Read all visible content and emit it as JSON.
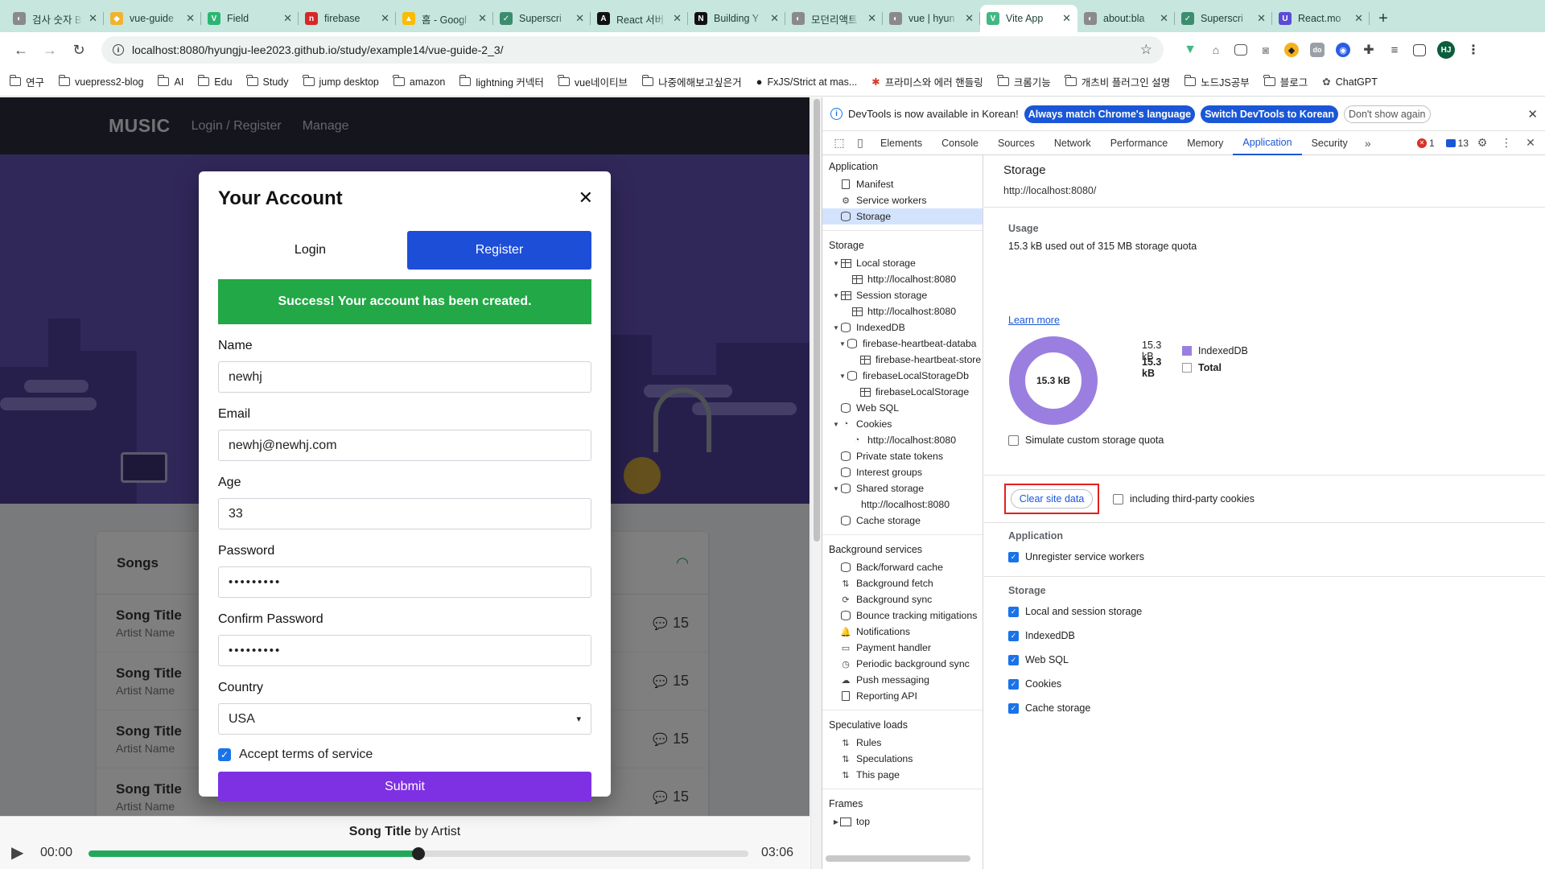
{
  "tabs": [
    {
      "title": "검사 숫자 B",
      "color": "#8a8a8a",
      "glyph": "◐"
    },
    {
      "title": "vue-guide",
      "color": "#f0b32f",
      "glyph": "◆"
    },
    {
      "title": "Field",
      "color": "#2bb673",
      "glyph": "V"
    },
    {
      "title": "firebase",
      "color": "#d62828",
      "glyph": "n"
    },
    {
      "title": "홈 - Googl",
      "color": "#fbbc04",
      "glyph": "▲"
    },
    {
      "title": "Superscri",
      "color": "#3b8d6e",
      "glyph": "✓"
    },
    {
      "title": "React 서버",
      "color": "#111111",
      "glyph": "A"
    },
    {
      "title": "Building Y",
      "color": "#111111",
      "glyph": "N"
    },
    {
      "title": "모던리액트",
      "color": "#8a8a8a",
      "glyph": "◐"
    },
    {
      "title": "vue | hyun",
      "color": "#8a8a8a",
      "glyph": "◐"
    },
    {
      "title": "Vite App",
      "color": "#42b883",
      "glyph": "V",
      "active": true
    },
    {
      "title": "about:bla",
      "color": "#8a8a8a",
      "glyph": "◐"
    },
    {
      "title": "Superscri",
      "color": "#3b8d6e",
      "glyph": "✓"
    },
    {
      "title": "React.mo",
      "color": "#5b4bd6",
      "glyph": "U"
    }
  ],
  "omnibox": {
    "url": "localhost:8080/hyungju-lee2023.github.io/study/example14/vue-guide-2_3/"
  },
  "profile_initials": "HJ",
  "bookmarks": [
    "연구",
    "vuepress2-blog",
    "AI",
    "Edu",
    "Study",
    "jump desktop",
    "amazon",
    "lightning 커넥터",
    "vue네이티브",
    "나중에해보고싶은거",
    "FxJS/Strict at mas...",
    "프라미스와 에러 핸들링",
    "크롬기능",
    "개츠비 플러그인 설명",
    "노드JS공부",
    "블로그",
    "ChatGPT"
  ],
  "site": {
    "brand": "MUSIC",
    "nav": [
      "Login / Register",
      "Manage"
    ],
    "songs_heading": "Songs",
    "songs": [
      {
        "title": "Song Title",
        "artist": "Artist Name",
        "count": "15"
      },
      {
        "title": "Song Title",
        "artist": "Artist Name",
        "count": "15"
      },
      {
        "title": "Song Title",
        "artist": "Artist Name",
        "count": "15"
      },
      {
        "title": "Song Title",
        "artist": "Artist Name",
        "count": "15"
      }
    ],
    "player": {
      "song": "Song Title",
      "by": "by Artist",
      "time_start": "00:00",
      "time_end": "03:06",
      "progress": 0.5
    }
  },
  "modal": {
    "title": "Your Account",
    "tab_login": "Login",
    "tab_register": "Register",
    "alert": "Success! Your account has been created.",
    "fields": {
      "name_label": "Name",
      "name_value": "newhj",
      "email_label": "Email",
      "email_value": "newhj@newhj.com",
      "age_label": "Age",
      "age_value": "33",
      "password_label": "Password",
      "password_value": "•••••••••",
      "confirm_label": "Confirm Password",
      "confirm_value": "•••••••••",
      "country_label": "Country",
      "country_value": "USA"
    },
    "terms": "Accept terms of service",
    "submit": "Submit"
  },
  "devtools": {
    "banner": {
      "message": "DevTools is now available in Korean!",
      "btn_match": "Always match Chrome's language",
      "btn_switch": "Switch DevTools to Korean",
      "btn_dismiss": "Don't show again"
    },
    "tabs": [
      "Elements",
      "Console",
      "Sources",
      "Network",
      "Performance",
      "Memory",
      "Application",
      "Security"
    ],
    "active_tab": "Application",
    "error_count": "1",
    "message_count": "13",
    "sidebar": {
      "application_heading": "Application",
      "application_items": [
        "Manifest",
        "Service workers",
        "Storage"
      ],
      "storage_heading": "Storage",
      "local_storage": "Local storage",
      "local_origin": "http://localhost:8080",
      "session_storage": "Session storage",
      "session_origin": "http://localhost:8080",
      "indexeddb": "IndexedDB",
      "idb_db1": "firebase-heartbeat-databa",
      "idb_store1": "firebase-heartbeat-store",
      "idb_db2": "firebaseLocalStorageDb",
      "idb_store2": "firebaseLocalStorage",
      "web_sql": "Web SQL",
      "cookies": "Cookies",
      "cookies_origin": "http://localhost:8080",
      "private_state": "Private state tokens",
      "interest_groups": "Interest groups",
      "shared_storage": "Shared storage",
      "shared_origin": "http://localhost:8080",
      "cache_storage": "Cache storage",
      "bg_heading": "Background services",
      "bg_items": [
        "Back/forward cache",
        "Background fetch",
        "Background sync",
        "Bounce tracking mitigations",
        "Notifications",
        "Payment handler",
        "Periodic background sync",
        "Push messaging",
        "Reporting API"
      ],
      "spec_heading": "Speculative loads",
      "spec_items": [
        "Rules",
        "Speculations",
        "This page"
      ],
      "frames_heading": "Frames",
      "frames_top": "top"
    },
    "main": {
      "title": "Storage",
      "origin": "http://localhost:8080/",
      "usage_heading": "Usage",
      "usage_text": "15.3 kB used out of 315 MB storage quota",
      "learn_more": "Learn more",
      "donut_label": "15.3 kB",
      "legend": [
        {
          "value": "15.3 kB",
          "name": "IndexedDB",
          "color": "#9a7fe0"
        },
        {
          "value": "15.3 kB",
          "name": "Total",
          "color": "#ffffff"
        }
      ],
      "simulate": "Simulate custom storage quota",
      "clear_btn": "Clear site data",
      "third_party": "including third-party cookies",
      "app_heading": "Application",
      "unregister": "Unregister service workers",
      "storage_heading": "Storage",
      "checks": [
        "Local and session storage",
        "IndexedDB",
        "Web SQL",
        "Cookies",
        "Cache storage"
      ]
    }
  }
}
